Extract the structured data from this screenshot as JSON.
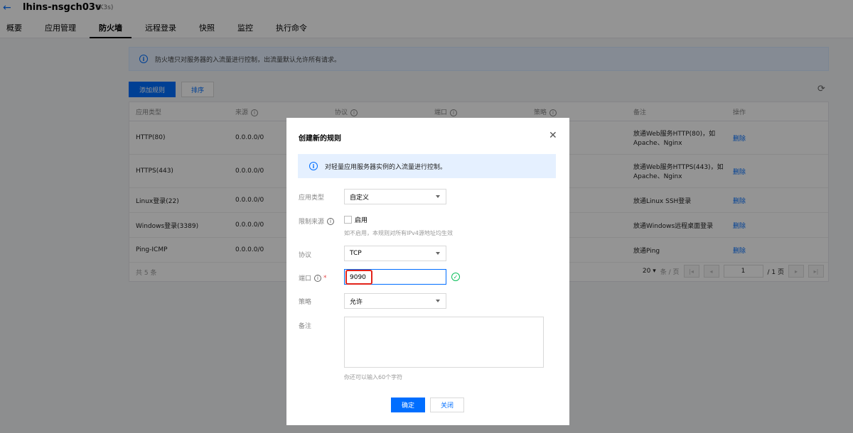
{
  "header": {
    "back_icon": "arrow-left-icon",
    "instance_name": "lhins-nsgch03v",
    "instance_tag": "(K3s)"
  },
  "tabs": [
    {
      "label": "概要",
      "active": false
    },
    {
      "label": "应用管理",
      "active": false
    },
    {
      "label": "防火墙",
      "active": true
    },
    {
      "label": "远程登录",
      "active": false
    },
    {
      "label": "快照",
      "active": false
    },
    {
      "label": "监控",
      "active": false
    },
    {
      "label": "执行命令",
      "active": false
    }
  ],
  "firewall": {
    "notice": "防火墙只对服务器的入流量进行控制，出流量默认允许所有请求。",
    "add_button": "添加规则",
    "sort_button": "排序",
    "columns": [
      "应用类型",
      "来源",
      "协议",
      "端口",
      "策略",
      "备注",
      "操作"
    ],
    "rows": [
      {
        "type": "HTTP(80)",
        "source": "0.0.0.0/0",
        "note": "放通Web服务HTTP(80)，如Apache、Nginx",
        "action": "删除"
      },
      {
        "type": "HTTPS(443)",
        "source": "0.0.0.0/0",
        "note": "放通Web服务HTTPS(443)，如Apache、Nginx",
        "action": "删除"
      },
      {
        "type": "Linux登录(22)",
        "source": "0.0.0.0/0",
        "note": "放通Linux SSH登录",
        "action": "删除"
      },
      {
        "type": "Windows登录(3389)",
        "source": "0.0.0.0/0",
        "note": "放通Windows远程桌面登录",
        "action": "删除"
      },
      {
        "type": "Ping-ICMP",
        "source": "0.0.0.0/0",
        "note": "放通Ping",
        "action": "删除"
      }
    ],
    "total": "共 5 条",
    "page_size": "20",
    "page_size_unit": "条 / 页",
    "page": "1",
    "page_total": "/ 1 页"
  },
  "modal": {
    "title": "创建新的规则",
    "notice": "对轻量应用服务器实例的入流量进行控制。",
    "labels": {
      "app_type": "应用类型",
      "limit_source": "限制来源",
      "protocol": "协议",
      "port": "端口",
      "policy": "策略",
      "note": "备注"
    },
    "app_type_value": "自定义",
    "limit_source_checkbox": "启用",
    "limit_source_hint": "如不启用，本规则对所有IPv4源地址均生效",
    "protocol_value": "TCP",
    "port_value": "9090",
    "policy_value": "允许",
    "note_value": "",
    "note_hint": "你还可以输入60个字符",
    "ok_button": "确定",
    "cancel_button": "关闭"
  }
}
